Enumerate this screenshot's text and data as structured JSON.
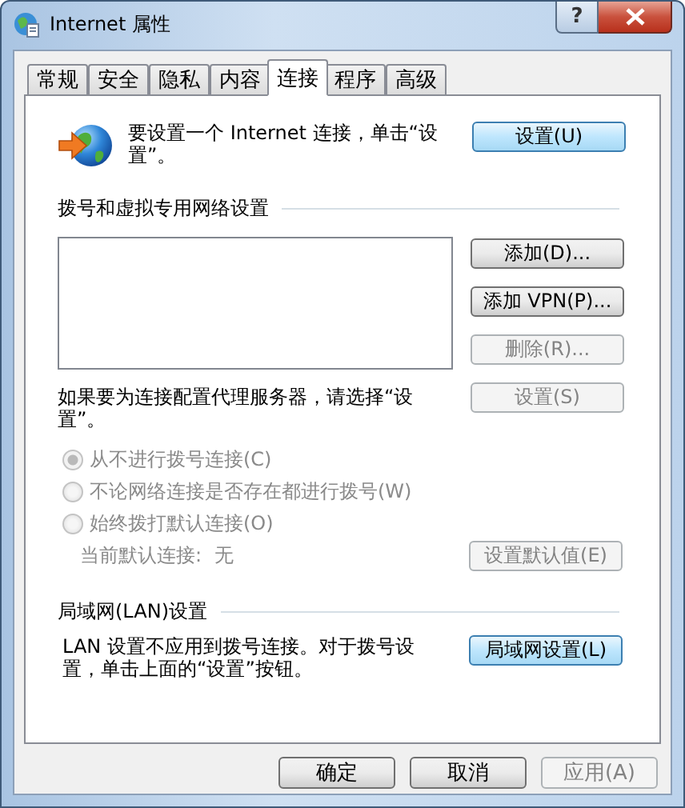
{
  "window": {
    "title": "Internet 属性",
    "help_button": "?"
  },
  "tabs": [
    {
      "label": "常规",
      "selected": false
    },
    {
      "label": "安全",
      "selected": false
    },
    {
      "label": "隐私",
      "selected": false
    },
    {
      "label": "内容",
      "selected": false
    },
    {
      "label": "连接",
      "selected": true
    },
    {
      "label": "程序",
      "selected": false
    },
    {
      "label": "高级",
      "selected": false
    }
  ],
  "setup": {
    "text": "要设置一个 Internet 连接，单击“设置”。",
    "button": {
      "label": "设置(U)",
      "highlighted": true,
      "disabled": false
    }
  },
  "dialup": {
    "heading": "拨号和虚拟专用网络设置",
    "buttons": [
      {
        "label": "添加(D)...",
        "highlighted": false,
        "disabled": false
      },
      {
        "label": "添加 VPN(P)...",
        "highlighted": false,
        "disabled": false
      },
      {
        "label": "删除(R)...",
        "highlighted": false,
        "disabled": true
      },
      {
        "label": "设置(S)",
        "highlighted": false,
        "disabled": true
      }
    ],
    "proxy_text": "如果要为连接配置代理服务器，请选择“设置”。",
    "options": [
      {
        "label": "从不进行拨号连接(C)",
        "selected": true,
        "disabled": true
      },
      {
        "label": "不论网络连接是否存在都进行拨号(W)",
        "selected": false,
        "disabled": true
      },
      {
        "label": "始终拨打默认连接(O)",
        "selected": false,
        "disabled": true
      }
    ],
    "current_default": {
      "label": "当前默认连接:",
      "value": "无",
      "disabled": true
    },
    "default_button": {
      "label": "设置默认值(E)",
      "highlighted": false,
      "disabled": true
    }
  },
  "lan": {
    "heading": "局域网(LAN)设置",
    "text": "LAN 设置不应用到拨号连接。对于拨号设置，单击上面的“设置”按钮。",
    "button": {
      "label": "局域网设置(L)",
      "highlighted": true,
      "disabled": false
    }
  },
  "footer_buttons": [
    {
      "label": "确定",
      "highlighted": false,
      "disabled": false
    },
    {
      "label": "取消",
      "highlighted": false,
      "disabled": false
    },
    {
      "label": "应用(A)",
      "highlighted": false,
      "disabled": true
    }
  ]
}
